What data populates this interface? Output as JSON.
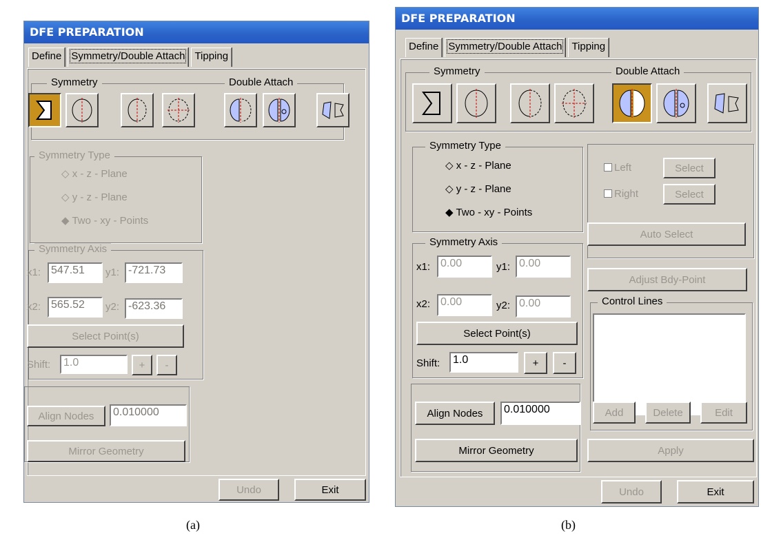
{
  "captions": {
    "a": "(a)",
    "b": "(b)"
  },
  "title": "DFE PREPARATION",
  "tabs": [
    "Define",
    "Symmetry/Double Attach",
    "Tipping"
  ],
  "symmetry_label": "Symmetry",
  "double_attach_label": "Double Attach",
  "symmetry_type": {
    "label": "Symmetry Type",
    "options": [
      "x - z - Plane",
      "y - z - Plane",
      "Two - xy - Points"
    ]
  },
  "axis": {
    "label": "Symmetry Axis",
    "x1": "x1:",
    "y1": "y1:",
    "x2": "x2:",
    "y2": "y2:"
  },
  "panel_a": {
    "x1": "547.51",
    "y1": "-721.73",
    "x2": "565.52",
    "y2": "-623.36",
    "shift": "1.0",
    "align": "0.010000"
  },
  "panel_b": {
    "x1": "0.00",
    "y1": "0.00",
    "x2": "0.00",
    "y2": "0.00",
    "shift": "1.0",
    "align": "0.010000"
  },
  "buttons": {
    "select_points": "Select Point(s)",
    "shift": "Shift:",
    "plus": "+",
    "minus": "-",
    "align_nodes": "Align Nodes",
    "mirror": "Mirror Geometry",
    "undo": "Undo",
    "exit": "Exit",
    "left": "Left",
    "right": "Right",
    "select": "Select",
    "auto_select": "Auto Select",
    "adjust": "Adjust Bdy-Point",
    "control_lines": "Control Lines",
    "add": "Add",
    "delete": "Delete",
    "edit": "Edit",
    "apply": "Apply"
  }
}
